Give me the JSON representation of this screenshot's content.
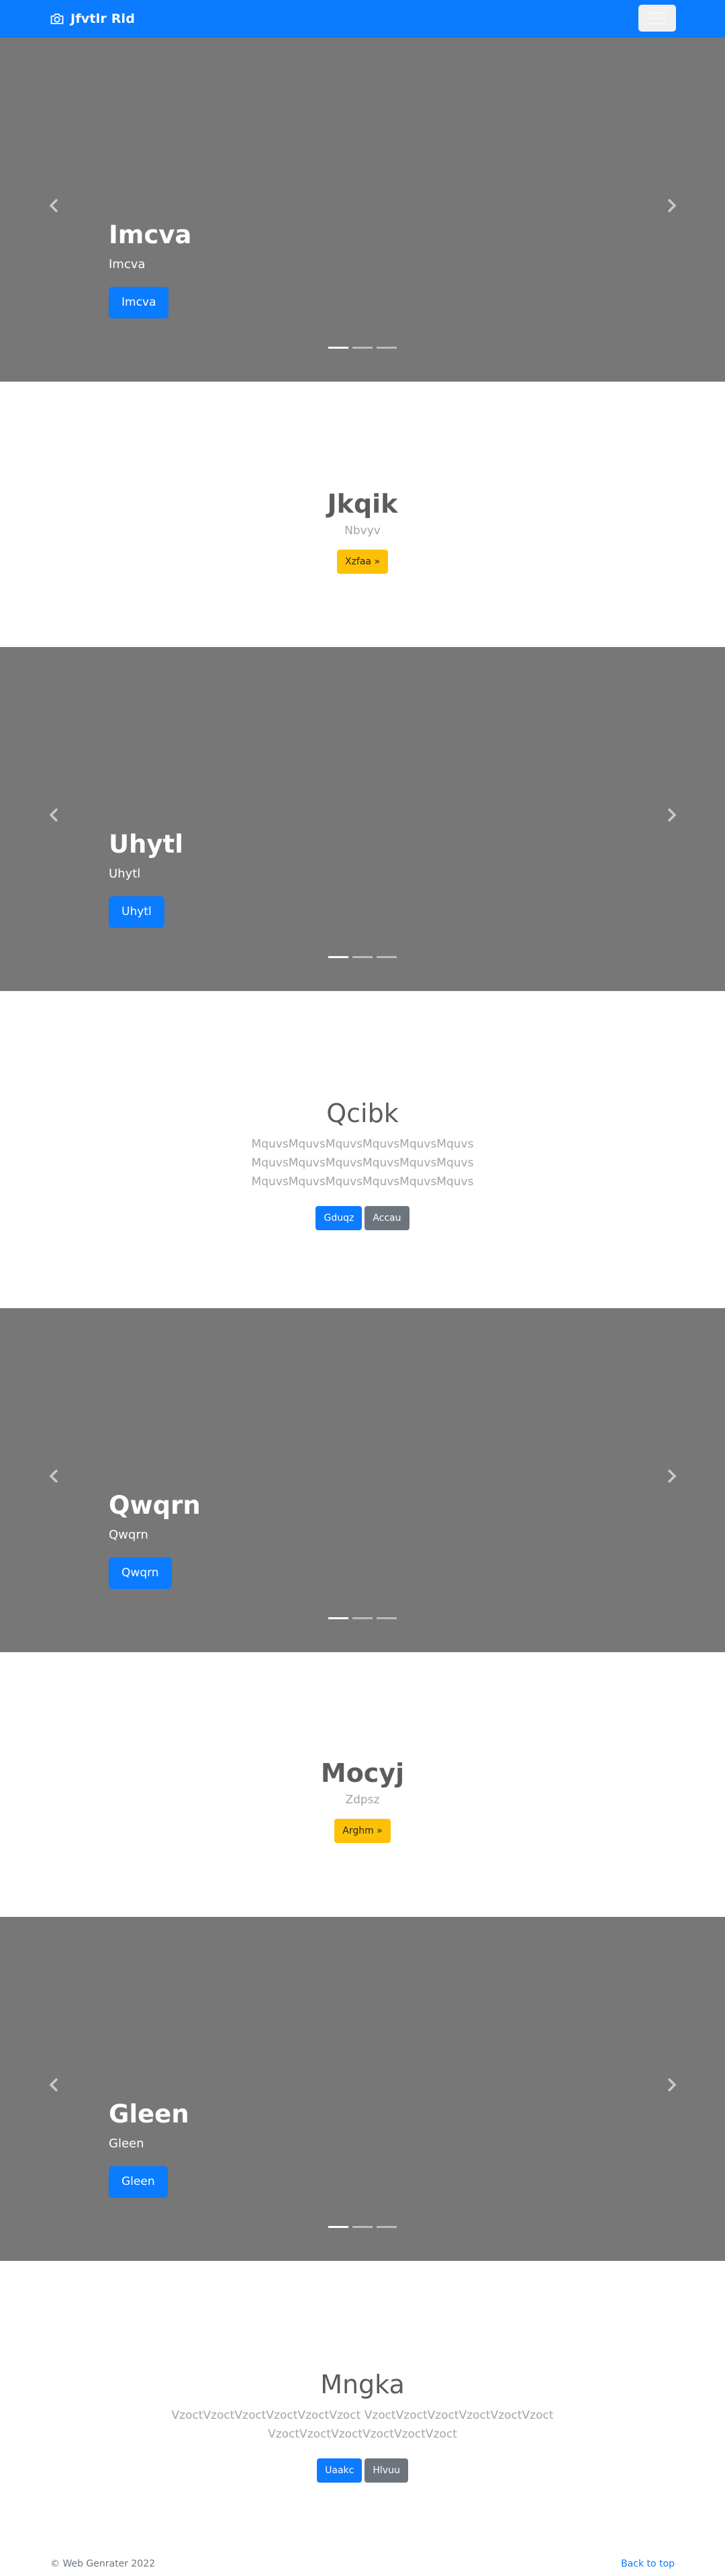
{
  "navbar": {
    "brand": "Jfvtlr Rld",
    "brand_icon": "camera-icon",
    "toggler_icon": "hamburger-menu-icon"
  },
  "carousels": [
    {
      "title": "Imcva",
      "subtitle": "Imcva",
      "button": "Imcva"
    },
    {
      "title": "Uhytl",
      "subtitle": "Uhytl",
      "button": "Uhytl"
    },
    {
      "title": "Qwqrn",
      "subtitle": "Qwqrn",
      "button": "Qwqrn"
    },
    {
      "title": "Gleen",
      "subtitle": "Gleen",
      "button": "Gleen"
    }
  ],
  "features": [
    {
      "heading": "Jkqik",
      "sub": "Nbvyv",
      "button": "Xzfaa »"
    },
    {
      "heading": "Qcibk",
      "lead": [
        "MquvsMquvsMquvsMquvsMquvsMquvs",
        "MquvsMquvsMquvsMquvsMquvsMquvs",
        "MquvsMquvsMquvsMquvsMquvsMquvs"
      ],
      "buttons": [
        "Gduqz",
        "Accau"
      ]
    },
    {
      "heading": "Mocyj",
      "sub": "Zdpsz",
      "button": "Arghm »"
    },
    {
      "heading": "Mngka",
      "lead": [
        "VzoctVzoctVzoctVzoctVzoctVzoct VzoctVzoctVzoctVzoctVzoctVzoct",
        "VzoctVzoctVzoctVzoctVzoctVzoct"
      ],
      "buttons": [
        "Uaakc",
        "Hlvuu"
      ]
    }
  ],
  "footer": {
    "copyright": "© Web Genrater 2022",
    "back_to_top": "Back to top"
  },
  "colors": {
    "primary": "#0b7bff",
    "carousel_bg": "#777777",
    "warning": "#ffc107",
    "secondary": "#6c757d"
  }
}
